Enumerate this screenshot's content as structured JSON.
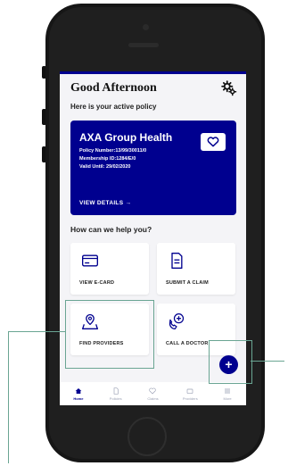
{
  "header": {
    "greeting": "Good Afternoon",
    "settings_icon": "settings-gear-icon"
  },
  "policy_section": {
    "subtitle": "Here is your active policy"
  },
  "policy_card": {
    "title": "AXA Group Health",
    "policy_number": "Policy Number:13/99/30011/0",
    "membership_id": "Membership ID:1284/E/0",
    "valid_until": "Valid Until: 29/02/2020",
    "view_details": "VIEW DETAILS →",
    "color": "#00008f",
    "icon": "heart-icon"
  },
  "help_section": {
    "title": "How can we help you?"
  },
  "tiles": [
    {
      "label": "VIEW E-CARD",
      "icon": "card-icon"
    },
    {
      "label": "SUBMIT A CLAIM",
      "icon": "document-icon"
    },
    {
      "label": "FIND PROVIDERS",
      "icon": "map-pin-icon"
    },
    {
      "label": "CALL A DOCTOR",
      "icon": "call-doctor-icon"
    }
  ],
  "fab": {
    "label": "+",
    "icon": "plus-icon"
  },
  "tabbar": [
    {
      "label": "Home",
      "icon": "home-icon",
      "active": true
    },
    {
      "label": "Policies",
      "icon": "policies-icon",
      "active": false
    },
    {
      "label": "Claims",
      "icon": "claims-icon",
      "active": false
    },
    {
      "label": "Providers",
      "icon": "providers-icon",
      "active": false
    },
    {
      "label": "More",
      "icon": "menu-icon",
      "active": false
    }
  ],
  "colors": {
    "brand": "#00008f",
    "highlight": "#6aa593",
    "muted": "#9aa0b4"
  }
}
